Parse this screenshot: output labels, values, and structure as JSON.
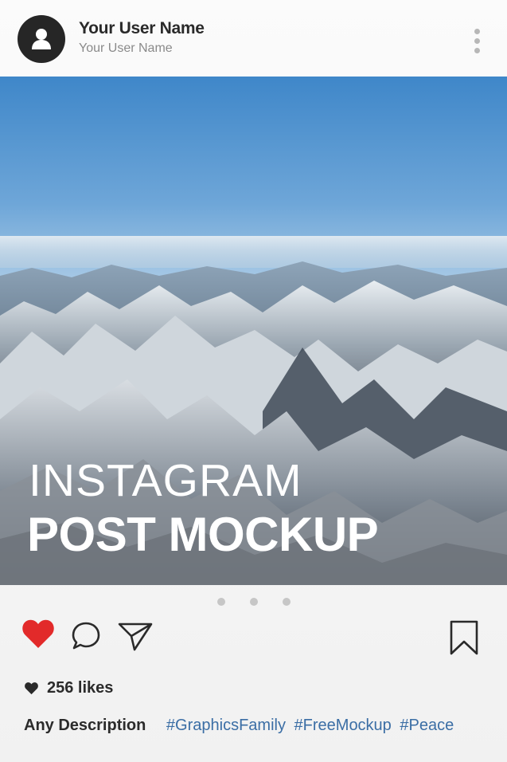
{
  "post": {
    "user_name": "Your User Name",
    "user_handle": "Your User Name",
    "overlay_line1": "INSTAGRAM",
    "overlay_line2": "POST MOCKUP",
    "likes_text": "256 likes",
    "description_label": "Any Description",
    "hashtags": [
      "#GraphicsFamily",
      "#FreeMockup",
      "#Peace"
    ]
  },
  "pager": {
    "dots": 3
  },
  "icons": {
    "avatar": "user-silhouette-icon",
    "more": "more-vertical-icon",
    "like": "heart-icon",
    "comment": "comment-icon",
    "share": "send-icon",
    "save": "bookmark-icon",
    "likes_small": "heart-small-icon"
  },
  "colors": {
    "like_heart": "#e22a2a",
    "hashtag": "#3b6ea5",
    "avatar_bg": "#262626"
  }
}
